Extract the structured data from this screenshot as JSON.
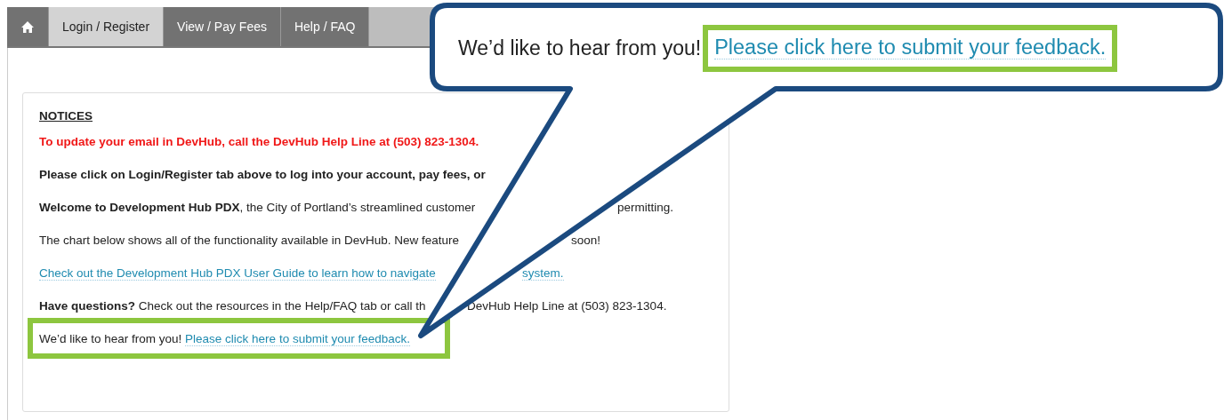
{
  "tabs": [
    {
      "kind": "home",
      "selected": false
    },
    {
      "kind": "text",
      "label": "Login / Register",
      "selected": true
    },
    {
      "kind": "text",
      "label": "View / Pay Fees",
      "selected": false
    },
    {
      "kind": "text",
      "label": "Help / FAQ",
      "selected": false
    }
  ],
  "notices": {
    "heading": "NOTICES",
    "lines": [
      {
        "kind": "alert",
        "text": "To update your email in DevHub, call the DevHub Help Line at (503) 823-1304."
      },
      {
        "kind": "bold",
        "text": "Please click on Login/Register tab above to log into your account, pay fees, or"
      },
      {
        "kind": "plain",
        "text": "**Welcome to Development Hub PDX**, the City of Portland’s streamlined customer",
        "after": "permitting."
      },
      {
        "kind": "plain",
        "text": "The chart below shows all of the functionality available in DevHub. New feature",
        "after": "soon!"
      },
      {
        "kind": "link",
        "text": "Check out the Development Hub PDX User Guide to learn how to navigate",
        "after": "system."
      },
      {
        "kind": "plain",
        "text": "**Have questions?** Check out the resources in the Help/FAQ tab or call th",
        "after": "DevHub Help Line at (503) 823-1304."
      },
      {
        "kind": "feedback",
        "text": "We’d like to hear from you!",
        "link": "Please click here to submit your feedback.",
        "highlighted": true
      }
    ]
  },
  "callout": {
    "text": "We’d like to hear from you!",
    "link": "Please click here to submit your feedback.",
    "highlighted": true
  }
}
